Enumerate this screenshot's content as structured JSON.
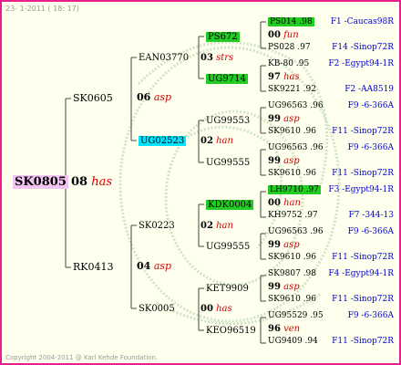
{
  "header": "23-  1-2011 ( 18: 17)",
  "footer": "Copyright 2004-2011 @ Karl Kehde Foundation.",
  "gen1": {
    "id": "SK0805",
    "year": "08",
    "breeder": "has"
  },
  "gen2": [
    {
      "id": "SK0605",
      "year": "06",
      "breeder": "asp"
    },
    {
      "id": "RK0413",
      "year": "04",
      "breeder": "asp"
    }
  ],
  "gen3": [
    {
      "id": "EAN03770"
    },
    {
      "id": "UG02523"
    },
    {
      "id": "SK0223"
    },
    {
      "id": "SK0005"
    }
  ],
  "gen4": [
    {
      "id": "PS672",
      "year": "03",
      "breeder": "strs"
    },
    {
      "id": "UG9714"
    },
    {
      "id": "UG99553"
    },
    {
      "id": "UG99555",
      "year": "02",
      "breeder": "han"
    },
    {
      "id": "KDK0004",
      "year": "02",
      "breeder": "han"
    },
    {
      "id": "UG99555"
    },
    {
      "id": "KET9909"
    },
    {
      "id": "KEO96519",
      "year": "00",
      "breeder": "has"
    }
  ],
  "gen5": [
    {
      "id": "PS014 .98",
      "cls": "F1 -Caucas98R"
    },
    {
      "year": "00",
      "breeder": "fun"
    },
    {
      "id": "PS028 .97",
      "cls": "F14 -Sinop72R"
    },
    {
      "id": "KB-80 .95",
      "cls": "F2 -Egypt94-1R"
    },
    {
      "year": "97",
      "breeder": "has"
    },
    {
      "id": "SK9221 .92",
      "cls": "F2 -AA8519"
    },
    {
      "id": "UG96563 .96",
      "cls": "F9 -6-366A"
    },
    {
      "year": "99",
      "breeder": "asp"
    },
    {
      "id": "SK9610 .96",
      "cls": "F11 -Sinop72R"
    },
    {
      "id": "UG96563 .96",
      "cls": "F9 -6-366A"
    },
    {
      "year": "99",
      "breeder": "asp"
    },
    {
      "id": "SK9610 .96",
      "cls": "F11 -Sinop72R"
    },
    {
      "id": "LH9710 .97",
      "cls": "F3 -Egypt94-1R"
    },
    {
      "year": "00",
      "breeder": "han"
    },
    {
      "id": "KH9752 .97",
      "cls": "F7 -344-13"
    },
    {
      "id": "UG96563 .96",
      "cls": "F9 -6-366A"
    },
    {
      "year": "99",
      "breeder": "asp"
    },
    {
      "id": "SK9610 .96",
      "cls": "F11 -Sinop72R"
    },
    {
      "id": "SK9807 .98",
      "cls": "F4 -Egypt94-1R"
    },
    {
      "year": "99",
      "breeder": "asp"
    },
    {
      "id": "SK9610 .96",
      "cls": "F11 -Sinop72R"
    },
    {
      "id": "UG95529 .95",
      "cls": "F9 -6-366A"
    },
    {
      "year": "96",
      "breeder": "ven"
    },
    {
      "id": "UG9409 .94",
      "cls": "F11 -Sinop72R"
    }
  ]
}
